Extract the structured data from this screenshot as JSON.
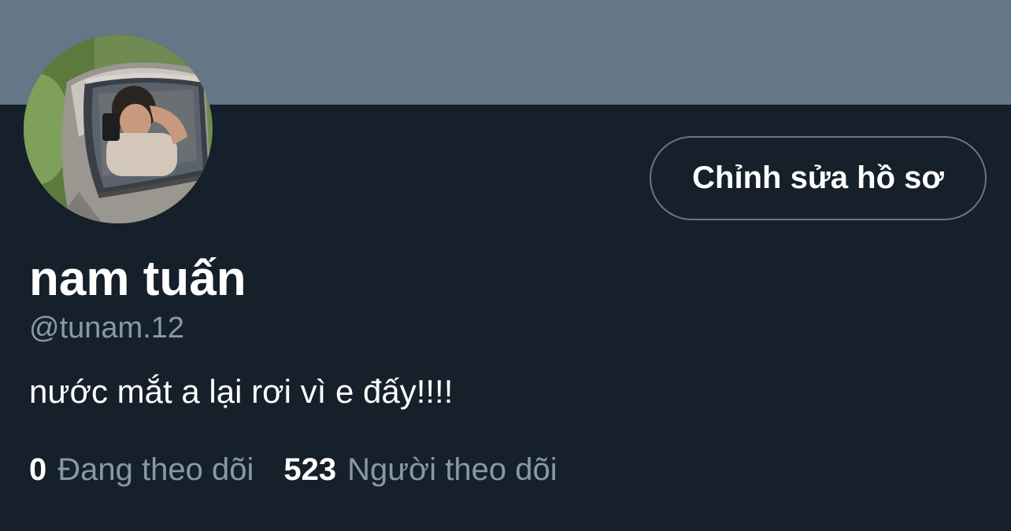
{
  "header": {
    "banner_color": "#657786"
  },
  "profile": {
    "avatar_alt": "avatar",
    "display_name": "nam tuấn",
    "handle": "@tunam.12",
    "bio": "nước mắt a lại rơi vì e đấy!!!!",
    "edit_button_label": "Chỉnh sửa hồ sơ"
  },
  "stats": {
    "following_count": "0",
    "following_label": "Đang theo dõi",
    "followers_count": "523",
    "followers_label": "Người theo dõi"
  },
  "colors": {
    "background": "#15202b",
    "secondary_text": "#8899a6",
    "button_border": "#657786"
  }
}
